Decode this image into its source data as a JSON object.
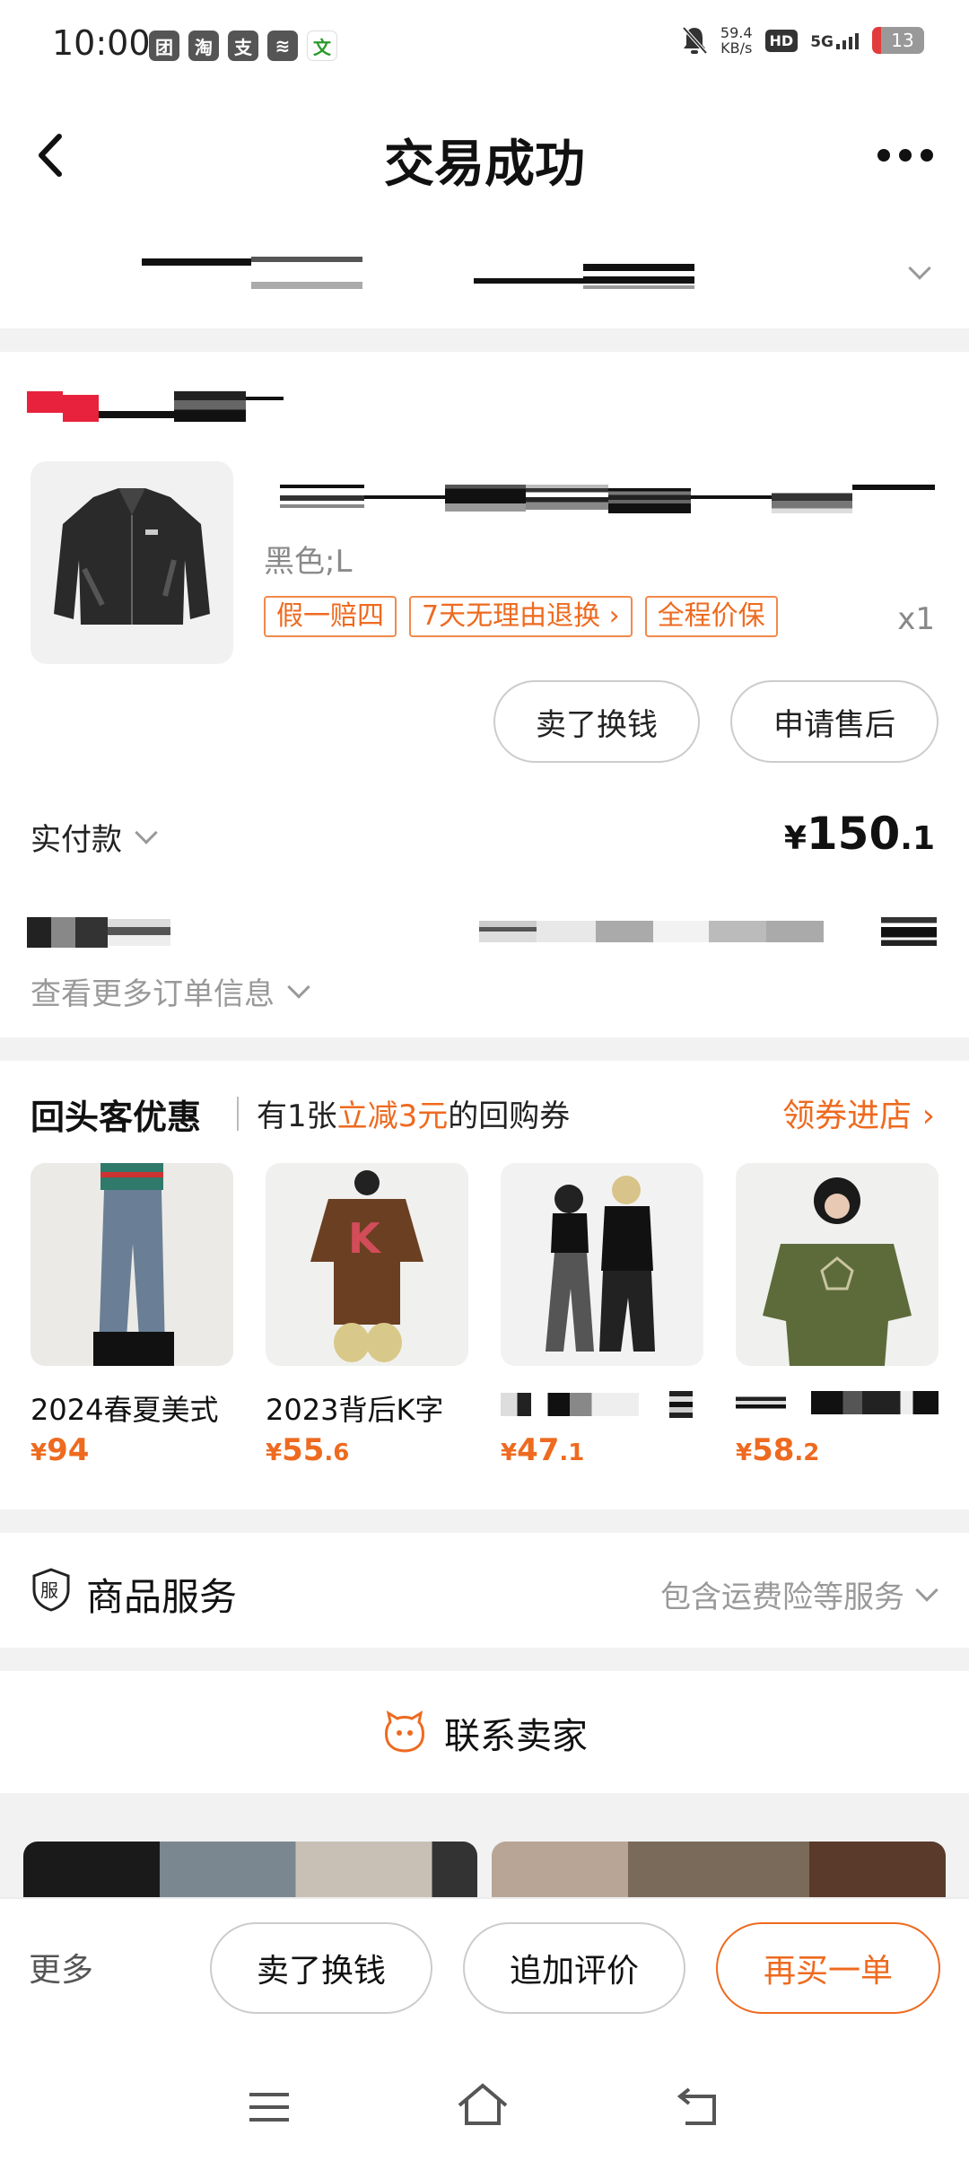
{
  "status_bar": {
    "time": "10:00",
    "apps": [
      "团",
      "淘",
      "支",
      "≋",
      "文"
    ],
    "speed_value": "59.4",
    "speed_unit": "KB/s",
    "hd": "HD",
    "network": "5G",
    "battery": "13"
  },
  "header": {
    "title": "交易成功"
  },
  "product": {
    "spec": "黑色;L",
    "tags": [
      "假一赔四",
      "7天无理由退换",
      "全程价保"
    ],
    "tag_arrow": "›",
    "quantity": "x1",
    "buttons": {
      "sell": "卖了换钱",
      "after_sale": "申请售后"
    }
  },
  "payment": {
    "label": "实付款",
    "currency": "¥",
    "amount_int": "150",
    "amount_dec": ".1",
    "more_info": "查看更多订单信息"
  },
  "returning_customer": {
    "title": "回头客优惠",
    "desc_prefix": "有1张",
    "desc_highlight": "立减3元",
    "desc_suffix": "的回购券",
    "link": "领券进店 ›",
    "items": [
      {
        "name": "2024春夏美式",
        "currency": "¥",
        "price_int": "94",
        "price_dec": ""
      },
      {
        "name": "2023背后K字",
        "currency": "¥",
        "price_int": "55",
        "price_dec": ".6"
      },
      {
        "name": "",
        "currency": "¥",
        "price_int": "47",
        "price_dec": ".1"
      },
      {
        "name": "",
        "currency": "¥",
        "price_int": "58",
        "price_dec": ".2"
      }
    ]
  },
  "service": {
    "icon_char": "服",
    "title": "商品服务",
    "detail": "包含运费险等服务"
  },
  "contact": {
    "label": "联系卖家"
  },
  "bottom_bar": {
    "more": "更多",
    "sell": "卖了换钱",
    "review": "追加评价",
    "rebuy": "再买一单"
  },
  "colors": {
    "accent": "#ee6a1f",
    "background": "#f2f2f2"
  }
}
